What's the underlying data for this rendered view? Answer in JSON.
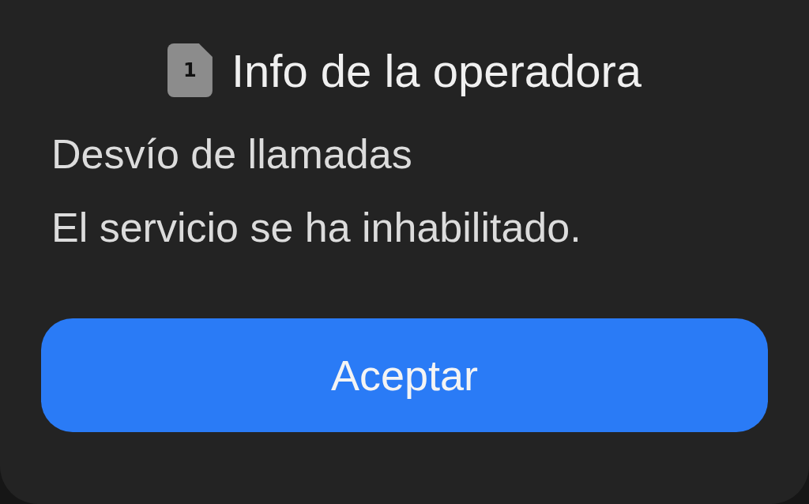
{
  "dialog": {
    "sim_slot": "1",
    "title": "Info de la operadora",
    "message": [
      "Desvío de llamadas",
      "El servicio se ha inhabilitado."
    ],
    "buttons": [
      {
        "label": "Aceptar",
        "kind": "primary"
      }
    ]
  }
}
